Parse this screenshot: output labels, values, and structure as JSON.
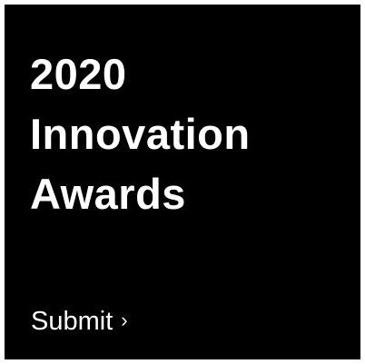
{
  "promo": {
    "headline_lines": [
      "2020",
      "Innovation",
      "Awards"
    ],
    "cta_label": "Submit",
    "cta_icon": "chevron-right-icon",
    "cta_glyph": "›"
  },
  "colors": {
    "background": "#000000",
    "text": "#ffffff",
    "page": "#ffffff"
  }
}
